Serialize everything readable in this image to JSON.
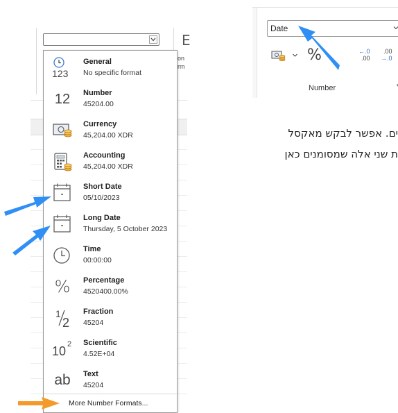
{
  "dropdown": {
    "items": [
      {
        "name": "General",
        "sample": "No specific format",
        "icon": "general-icon"
      },
      {
        "name": "Number",
        "sample": "45204.00",
        "icon": "number-icon",
        "glyph": "12"
      },
      {
        "name": "Currency",
        "sample": "45,204.00 XDR",
        "icon": "currency-icon"
      },
      {
        "name": "Accounting",
        "sample": " 45,204.00 XDR",
        "icon": "accounting-icon"
      },
      {
        "name": "Short Date",
        "sample": "05/10/2023",
        "icon": "short-date-icon"
      },
      {
        "name": "Long Date",
        "sample": "Thursday, 5 October 2023",
        "icon": "long-date-icon"
      },
      {
        "name": "Time",
        "sample": "00:00:00",
        "icon": "time-icon"
      },
      {
        "name": "Percentage",
        "sample": "4520400.00%",
        "icon": "percentage-icon",
        "glyph": "%"
      },
      {
        "name": "Fraction",
        "sample": "45204",
        "icon": "fraction-icon"
      },
      {
        "name": "Scientific",
        "sample": "4.52E+04",
        "icon": "scientific-icon"
      },
      {
        "name": "Text",
        "sample": "45204",
        "icon": "text-icon",
        "glyph": "ab"
      }
    ],
    "more_label": "More Number Formats...",
    "general_digits": "123",
    "fraction_num": "1",
    "fraction_den": "2",
    "sci_base": "10",
    "sci_exp": "2"
  },
  "left_ribbon": {
    "partial_line1": "on",
    "partial_line2": "rm",
    "big_glyph": "E"
  },
  "right_ribbon": {
    "format_value": "Date",
    "group_label": "Number",
    "percent_glyph": "%",
    "inc_decimal_top": ".0",
    "inc_decimal_bottom": ".00",
    "dec_decimal_top": ".00",
    "dec_decimal_bottom": ".0"
  },
  "hebrew": {
    "line1": "ים. אפשר לבקש מאקסל",
    "line2": "ת שני אלה שמסומנים כאן"
  },
  "colors": {
    "blue_arrow": "#2f8ff5",
    "orange_arrow": "#f39a2a"
  }
}
